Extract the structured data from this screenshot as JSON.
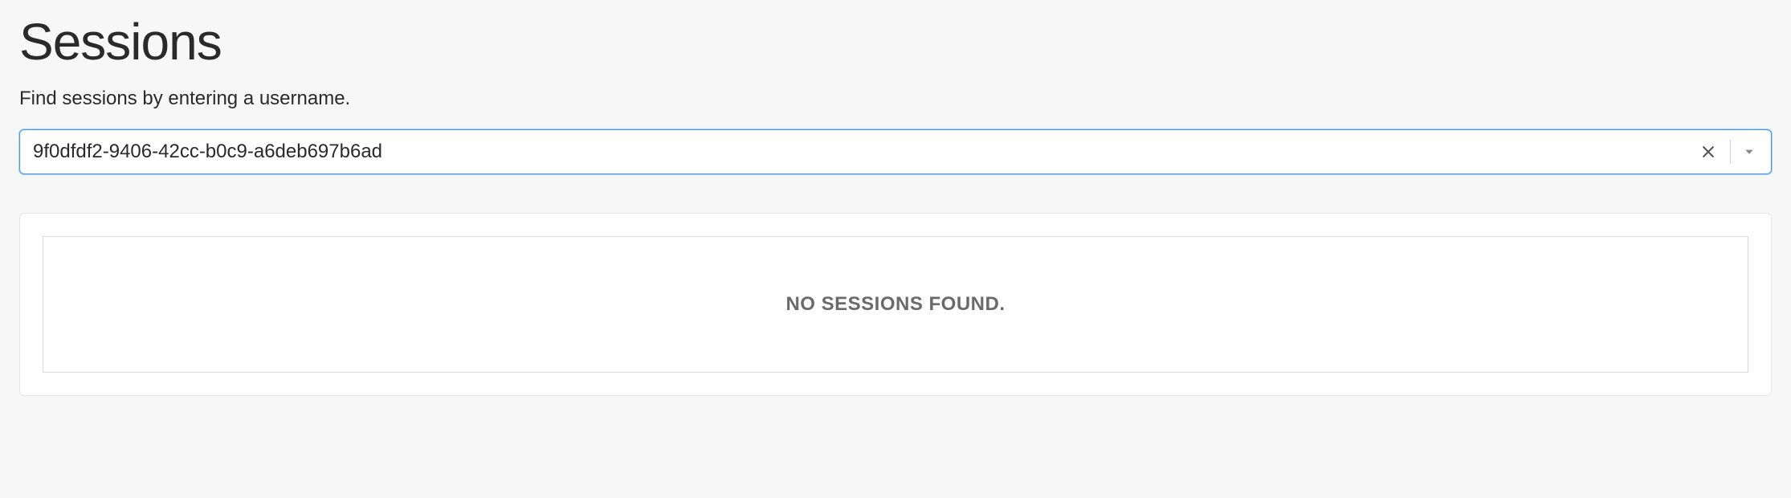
{
  "header": {
    "title": "Sessions",
    "subtitle": "Find sessions by entering a username."
  },
  "search": {
    "value": "9f0dfdf2-9406-42cc-b0c9-a6deb697b6ad",
    "placeholder": ""
  },
  "results": {
    "empty_message": "No sessions found."
  }
}
